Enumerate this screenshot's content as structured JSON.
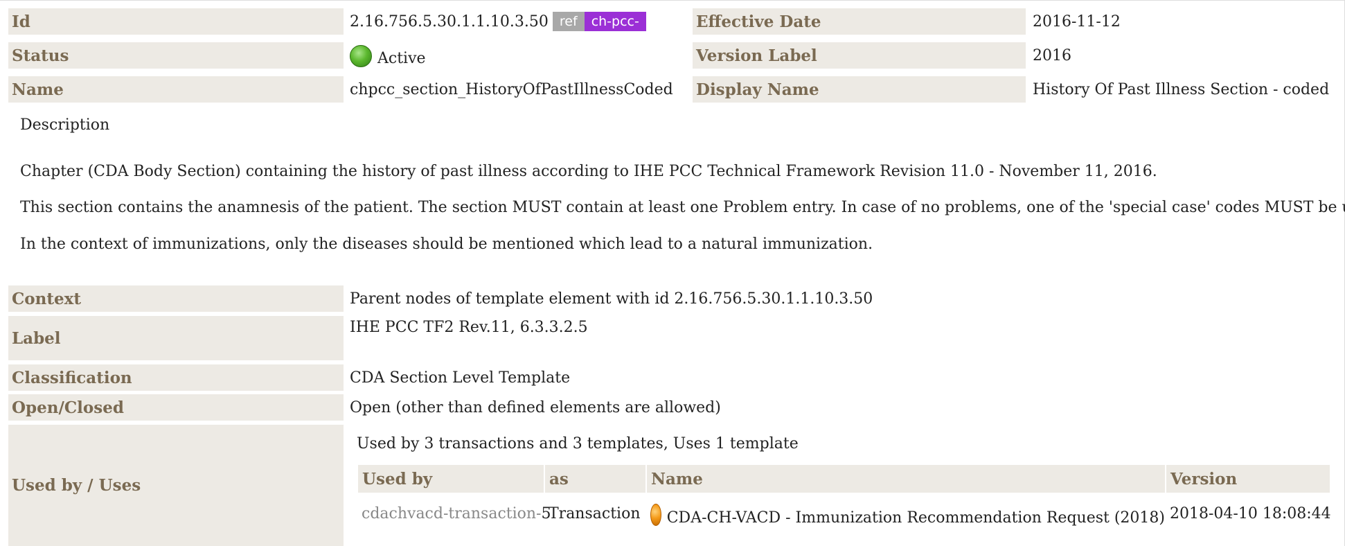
{
  "meta": {
    "id_label": "Id",
    "id_value": "2.16.756.5.30.1.1.10.3.50",
    "ref_tag": "ref",
    "prefix_tag": "ch-pcc-",
    "effective_date_label": "Effective Date",
    "effective_date_value": "2016-11-12",
    "status_label": "Status",
    "status_value": "Active",
    "version_label_label": "Version Label",
    "version_label_value": "2016",
    "name_label": "Name",
    "name_value": "chpcc_section_HistoryOfPastIllnessCoded",
    "display_name_label": "Display Name",
    "display_name_value": "History Of Past Illness Section - coded"
  },
  "description": {
    "heading": "Description",
    "paragraphs": [
      "Chapter (CDA Body Section) containing the history of past illness according to IHE PCC Technical Framework Revision 11.0 - November 11, 2016.",
      "This section contains the anamnesis of the patient. The section MUST contain at least one Problem entry. In case of no problems, one of the 'special case' codes MUST be used.",
      "In the context of immunizations, only the diseases should be mentioned which lead to a natural immunization."
    ]
  },
  "details": {
    "context_label": "Context",
    "context_value": "Parent nodes of template element with id 2.16.756.5.30.1.1.10.3.50",
    "label_label": "Label",
    "label_value": "IHE PCC TF2 Rev.11, 6.3.3.2.5",
    "classification_label": "Classification",
    "classification_value": "CDA Section Level Template",
    "open_closed_label": "Open/Closed",
    "open_closed_value": "Open (other than defined elements are allowed)",
    "used_by_label": "Used by / Uses",
    "used_by_summary": "Used by 3 transactions and 3 templates, Uses 1 template"
  },
  "usage_table": {
    "headers": [
      "Used by",
      "as",
      "Name",
      "Version"
    ],
    "rows": [
      {
        "used_by_prefix": "cdachvacd-transaction-",
        "used_by_suffix": "5",
        "as": "Transaction",
        "name": "CDA-CH-VACD - Immunization Recommendation Request (2018)",
        "version": "2018-04-10 18:08:44"
      }
    ]
  },
  "colors": {
    "header_bg": "#edeae4",
    "header_text": "#7a6a52",
    "prefix_tag_bg": "#9b2fd6",
    "ref_tag_bg": "#a8a8a8",
    "status_active": "green-dot",
    "transaction_status": "orange-dot"
  }
}
